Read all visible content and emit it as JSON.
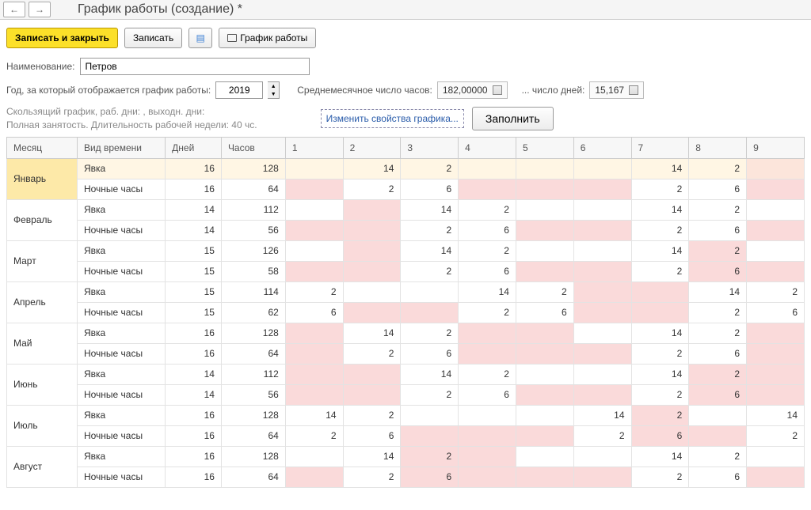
{
  "title": "График работы (создание) *",
  "toolbar": {
    "save_close": "Записать и закрыть",
    "save": "Записать",
    "print_schedule": "График работы"
  },
  "name_label": "Наименование:",
  "name_value": "Петров",
  "year_label": "Год, за который отображается график работы:",
  "year_value": "2019",
  "avg_hours_label": "Среднемесячное число часов:",
  "avg_hours_value": "182,00000",
  "avg_days_label": "... число дней:",
  "avg_days_value": "15,167",
  "info_line1": "Скользящий график, раб. дни: , выходн. дни:",
  "info_line2": "Полная занятость. Длительность рабочей недели: 40 чс.",
  "change_link": "Изменить свойства графика...",
  "fill_btn": "Заполнить",
  "headers": {
    "month": "Месяц",
    "time_type": "Вид времени",
    "days": "Дней",
    "hours": "Часов"
  },
  "day_cols": [
    "1",
    "2",
    "3",
    "4",
    "5",
    "6",
    "7",
    "8",
    "9"
  ],
  "type_yavka": "Явка",
  "type_night": "Ночные часы",
  "months": [
    {
      "name": "Январь",
      "highlight": true,
      "yavka_days": 16,
      "yavka_hours": 128,
      "night_days": 16,
      "night_hours": 64,
      "yavka_cells": [
        {
          "v": "",
          "p": false
        },
        {
          "v": "14",
          "p": false
        },
        {
          "v": "2",
          "p": false
        },
        {
          "v": "",
          "p": false
        },
        {
          "v": "",
          "p": false
        },
        {
          "v": "",
          "p": false
        },
        {
          "v": "14",
          "p": false
        },
        {
          "v": "2",
          "p": false
        },
        {
          "v": "",
          "p": true
        }
      ],
      "night_cells": [
        {
          "v": "",
          "p": true
        },
        {
          "v": "2",
          "p": false
        },
        {
          "v": "6",
          "p": false
        },
        {
          "v": "",
          "p": true
        },
        {
          "v": "",
          "p": true
        },
        {
          "v": "",
          "p": true
        },
        {
          "v": "2",
          "p": false
        },
        {
          "v": "6",
          "p": false
        },
        {
          "v": "",
          "p": true
        }
      ]
    },
    {
      "name": "Февраль",
      "yavka_days": 14,
      "yavka_hours": 112,
      "night_days": 14,
      "night_hours": 56,
      "yavka_cells": [
        {
          "v": "",
          "p": false
        },
        {
          "v": "",
          "p": true
        },
        {
          "v": "14",
          "p": false
        },
        {
          "v": "2",
          "p": false
        },
        {
          "v": "",
          "p": false
        },
        {
          "v": "",
          "p": false
        },
        {
          "v": "14",
          "p": false
        },
        {
          "v": "2",
          "p": false
        },
        {
          "v": "",
          "p": false
        }
      ],
      "night_cells": [
        {
          "v": "",
          "p": true
        },
        {
          "v": "",
          "p": true
        },
        {
          "v": "2",
          "p": false
        },
        {
          "v": "6",
          "p": false
        },
        {
          "v": "",
          "p": true
        },
        {
          "v": "",
          "p": true
        },
        {
          "v": "2",
          "p": false
        },
        {
          "v": "6",
          "p": false
        },
        {
          "v": "",
          "p": true
        }
      ]
    },
    {
      "name": "Март",
      "yavka_days": 15,
      "yavka_hours": 126,
      "night_days": 15,
      "night_hours": 58,
      "yavka_cells": [
        {
          "v": "",
          "p": false
        },
        {
          "v": "",
          "p": true
        },
        {
          "v": "14",
          "p": false
        },
        {
          "v": "2",
          "p": false
        },
        {
          "v": "",
          "p": false
        },
        {
          "v": "",
          "p": false
        },
        {
          "v": "14",
          "p": false
        },
        {
          "v": "2",
          "p": true
        },
        {
          "v": "",
          "p": false
        }
      ],
      "night_cells": [
        {
          "v": "",
          "p": true
        },
        {
          "v": "",
          "p": true
        },
        {
          "v": "2",
          "p": false
        },
        {
          "v": "6",
          "p": false
        },
        {
          "v": "",
          "p": true
        },
        {
          "v": "",
          "p": true
        },
        {
          "v": "2",
          "p": false
        },
        {
          "v": "6",
          "p": true
        },
        {
          "v": "",
          "p": true
        }
      ]
    },
    {
      "name": "Апрель",
      "yavka_days": 15,
      "yavka_hours": 114,
      "night_days": 15,
      "night_hours": 62,
      "yavka_cells": [
        {
          "v": "2",
          "p": false
        },
        {
          "v": "",
          "p": false
        },
        {
          "v": "",
          "p": false
        },
        {
          "v": "14",
          "p": false
        },
        {
          "v": "2",
          "p": false
        },
        {
          "v": "",
          "p": true
        },
        {
          "v": "",
          "p": true
        },
        {
          "v": "14",
          "p": false
        },
        {
          "v": "2",
          "p": false
        }
      ],
      "night_cells": [
        {
          "v": "6",
          "p": false
        },
        {
          "v": "",
          "p": true
        },
        {
          "v": "",
          "p": true
        },
        {
          "v": "2",
          "p": false
        },
        {
          "v": "6",
          "p": false
        },
        {
          "v": "",
          "p": true
        },
        {
          "v": "",
          "p": true
        },
        {
          "v": "2",
          "p": false
        },
        {
          "v": "6",
          "p": false
        }
      ]
    },
    {
      "name": "Май",
      "yavka_days": 16,
      "yavka_hours": 128,
      "night_days": 16,
      "night_hours": 64,
      "yavka_cells": [
        {
          "v": "",
          "p": true
        },
        {
          "v": "14",
          "p": false
        },
        {
          "v": "2",
          "p": false
        },
        {
          "v": "",
          "p": true
        },
        {
          "v": "",
          "p": true
        },
        {
          "v": "",
          "p": false
        },
        {
          "v": "14",
          "p": false
        },
        {
          "v": "2",
          "p": false
        },
        {
          "v": "",
          "p": true
        }
      ],
      "night_cells": [
        {
          "v": "",
          "p": true
        },
        {
          "v": "2",
          "p": false
        },
        {
          "v": "6",
          "p": false
        },
        {
          "v": "",
          "p": true
        },
        {
          "v": "",
          "p": true
        },
        {
          "v": "",
          "p": true
        },
        {
          "v": "2",
          "p": false
        },
        {
          "v": "6",
          "p": false
        },
        {
          "v": "",
          "p": true
        }
      ]
    },
    {
      "name": "Июнь",
      "yavka_days": 14,
      "yavka_hours": 112,
      "night_days": 14,
      "night_hours": 56,
      "yavka_cells": [
        {
          "v": "",
          "p": true
        },
        {
          "v": "",
          "p": true
        },
        {
          "v": "14",
          "p": false
        },
        {
          "v": "2",
          "p": false
        },
        {
          "v": "",
          "p": false
        },
        {
          "v": "",
          "p": false
        },
        {
          "v": "14",
          "p": false
        },
        {
          "v": "2",
          "p": true
        },
        {
          "v": "",
          "p": true
        }
      ],
      "night_cells": [
        {
          "v": "",
          "p": true
        },
        {
          "v": "",
          "p": true
        },
        {
          "v": "2",
          "p": false
        },
        {
          "v": "6",
          "p": false
        },
        {
          "v": "",
          "p": true
        },
        {
          "v": "",
          "p": true
        },
        {
          "v": "2",
          "p": false
        },
        {
          "v": "6",
          "p": true
        },
        {
          "v": "",
          "p": true
        }
      ]
    },
    {
      "name": "Июль",
      "yavka_days": 16,
      "yavka_hours": 128,
      "night_days": 16,
      "night_hours": 64,
      "yavka_cells": [
        {
          "v": "14",
          "p": false
        },
        {
          "v": "2",
          "p": false
        },
        {
          "v": "",
          "p": false
        },
        {
          "v": "",
          "p": false
        },
        {
          "v": "",
          "p": false
        },
        {
          "v": "14",
          "p": false
        },
        {
          "v": "2",
          "p": true
        },
        {
          "v": "",
          "p": false
        },
        {
          "v": "14",
          "p": false
        }
      ],
      "night_cells": [
        {
          "v": "2",
          "p": false
        },
        {
          "v": "6",
          "p": false
        },
        {
          "v": "",
          "p": true
        },
        {
          "v": "",
          "p": true
        },
        {
          "v": "",
          "p": true
        },
        {
          "v": "2",
          "p": false
        },
        {
          "v": "6",
          "p": true
        },
        {
          "v": "",
          "p": true
        },
        {
          "v": "2",
          "p": false
        }
      ]
    },
    {
      "name": "Август",
      "yavka_days": 16,
      "yavka_hours": 128,
      "night_days": 16,
      "night_hours": 64,
      "yavka_cells": [
        {
          "v": "",
          "p": false
        },
        {
          "v": "14",
          "p": false
        },
        {
          "v": "2",
          "p": true
        },
        {
          "v": "",
          "p": true
        },
        {
          "v": "",
          "p": false
        },
        {
          "v": "",
          "p": false
        },
        {
          "v": "14",
          "p": false
        },
        {
          "v": "2",
          "p": false
        },
        {
          "v": "",
          "p": false
        }
      ],
      "night_cells": [
        {
          "v": "",
          "p": true
        },
        {
          "v": "2",
          "p": false
        },
        {
          "v": "6",
          "p": true
        },
        {
          "v": "",
          "p": true
        },
        {
          "v": "",
          "p": true
        },
        {
          "v": "",
          "p": true
        },
        {
          "v": "2",
          "p": false
        },
        {
          "v": "6",
          "p": false
        },
        {
          "v": "",
          "p": true
        }
      ]
    }
  ]
}
